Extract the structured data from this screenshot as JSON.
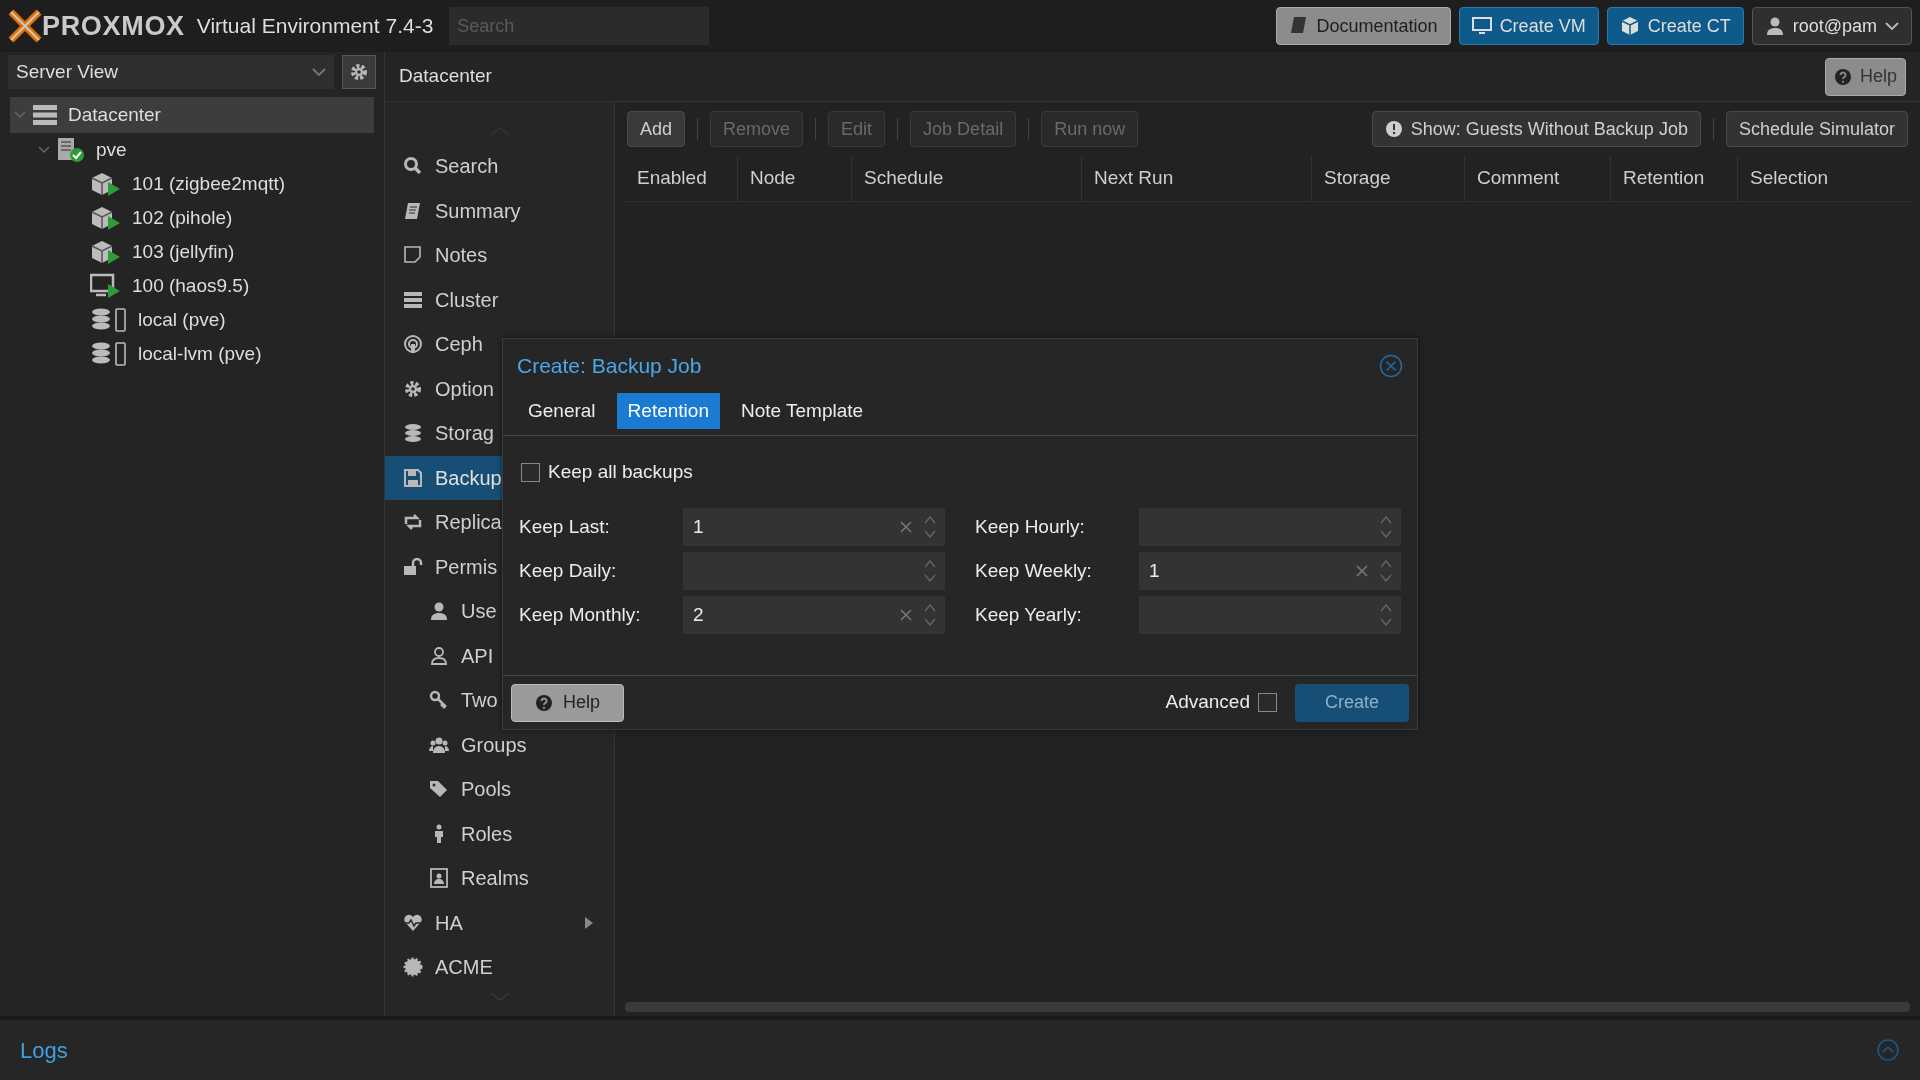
{
  "header": {
    "logo": "PROXMOX",
    "product": "Virtual Environment 7.4-3",
    "search": {
      "placeholder": "Search"
    },
    "buttons": [
      {
        "label": "Documentation",
        "kind": "doc"
      },
      {
        "label": "Create VM",
        "kind": "vm"
      },
      {
        "label": "Create CT",
        "kind": "ct"
      },
      {
        "label": "root@pam",
        "kind": "user"
      }
    ]
  },
  "sidebar": {
    "view": "Server View",
    "tree": [
      {
        "label": "Datacenter",
        "kind": "datacenter",
        "selected": true,
        "expanded": true,
        "children": [
          {
            "label": "pve",
            "kind": "node",
            "selected": false,
            "expanded": true,
            "children": [
              {
                "label": "101 (zigbee2mqtt)",
                "kind": "lxc",
                "selected": false
              },
              {
                "label": "102 (pihole)",
                "kind": "lxc",
                "selected": false
              },
              {
                "label": "103 (jellyfin)",
                "kind": "lxc",
                "selected": false
              },
              {
                "label": "100 (haos9.5)",
                "kind": "qemu",
                "selected": false
              },
              {
                "label": "local (pve)",
                "kind": "storage",
                "selected": false
              },
              {
                "label": "local-lvm (pve)",
                "kind": "storage",
                "selected": false
              }
            ]
          }
        ]
      }
    ]
  },
  "panel": {
    "title": "Datacenter",
    "help": "Help",
    "menu": [
      {
        "label": "Search",
        "kind": "item",
        "selected": false
      },
      {
        "label": "Summary",
        "kind": "item",
        "selected": false
      },
      {
        "label": "Notes",
        "kind": "item",
        "selected": false
      },
      {
        "label": "Cluster",
        "kind": "item",
        "selected": false
      },
      {
        "label": "Ceph",
        "kind": "item",
        "selected": false
      },
      {
        "label": "Option",
        "kind": "item",
        "selected": false
      },
      {
        "label": "Storag",
        "kind": "item",
        "selected": false
      },
      {
        "label": "Backup",
        "kind": "item",
        "selected": true
      },
      {
        "label": "Replica",
        "kind": "item",
        "selected": false
      },
      {
        "label": "Permis",
        "kind": "item",
        "selected": false
      },
      {
        "label": "Use",
        "kind": "sub",
        "selected": false
      },
      {
        "label": "API",
        "kind": "sub",
        "selected": false
      },
      {
        "label": "Two",
        "kind": "sub",
        "selected": false
      },
      {
        "label": "Groups",
        "kind": "sub",
        "selected": false
      },
      {
        "label": "Pools",
        "kind": "sub",
        "selected": false
      },
      {
        "label": "Roles",
        "kind": "sub",
        "selected": false
      },
      {
        "label": "Realms",
        "kind": "sub",
        "selected": false
      },
      {
        "label": "HA",
        "kind": "submenu",
        "selected": false
      },
      {
        "label": "ACME",
        "kind": "item",
        "selected": false
      }
    ],
    "toolbar": [
      {
        "label": "Add",
        "disabled": false
      },
      {
        "label": "Remove",
        "disabled": true
      },
      {
        "label": "Edit",
        "disabled": true
      },
      {
        "label": "Job Detail",
        "disabled": true
      },
      {
        "label": "Run now",
        "disabled": true
      }
    ],
    "toolbar_right": [
      {
        "label": "Show: Guests Without Backup Job",
        "kind": "info"
      },
      {
        "label": "Schedule Simulator",
        "kind": "plain"
      }
    ],
    "columns": [
      "Enabled",
      "Node",
      "Schedule",
      "Next Run",
      "Storage",
      "Comment",
      "Retention",
      "Selection"
    ]
  },
  "dialog": {
    "title": "Create: Backup Job",
    "tabs": [
      {
        "label": "General",
        "selected": false
      },
      {
        "label": "Retention",
        "selected": true
      },
      {
        "label": "Note Template",
        "selected": false
      }
    ],
    "keep_all": {
      "label": "Keep all backups",
      "checked": false
    },
    "fields": [
      {
        "label": "Keep Last:",
        "value": "1"
      },
      {
        "label": "Keep Hourly:"
      },
      {
        "label": "Keep Daily:"
      },
      {
        "label": "Keep Weekly:",
        "value": "1"
      },
      {
        "label": "Keep Monthly:",
        "value": "2"
      },
      {
        "label": "Keep Yearly:"
      }
    ],
    "help": "Help",
    "advanced": {
      "label": "Advanced",
      "checked": false
    },
    "create": "Create"
  },
  "logs": {
    "title": "Logs"
  }
}
